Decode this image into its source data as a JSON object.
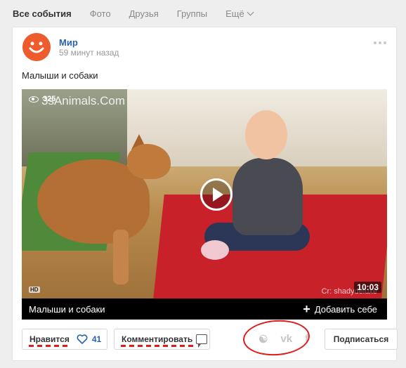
{
  "tabs": [
    "Все события",
    "Фото",
    "Друзья",
    "Группы",
    "Ещё"
  ],
  "post": {
    "author": "Мир",
    "time": "59 минут назад",
    "text": "Малыши и собаки"
  },
  "video": {
    "views": "325",
    "watermark": "3sAnimals.Com",
    "credit": "Cr: shadydeluxe",
    "hd": "HD",
    "duration": "10:03",
    "title": "Малыши и собаки",
    "add_label": "Добавить себе"
  },
  "actions": {
    "like_label": "Нравится",
    "like_count": "41",
    "comment_label": "Комментировать",
    "subscribe_label": "Подписаться",
    "share_icons": [
      "odnoklassniki-icon",
      "vk-icon",
      "facebook-icon"
    ]
  },
  "colors": {
    "link": "#2a63a8",
    "avatar": "#ee5c2e",
    "annotation": "#e01b1b"
  }
}
